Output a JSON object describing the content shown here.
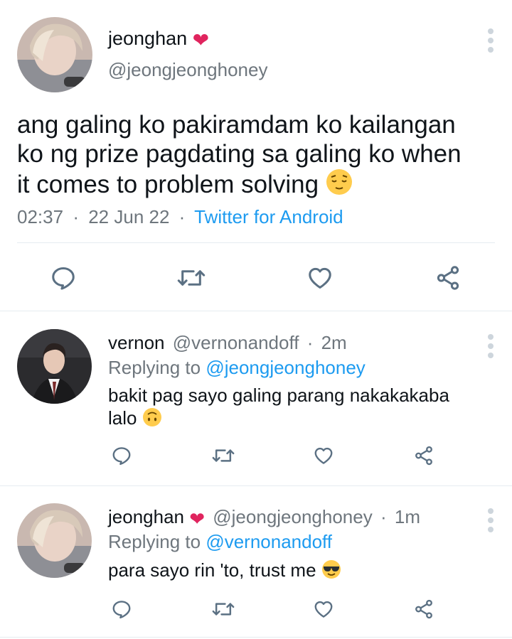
{
  "main_tweet": {
    "display_name": "jeonghan",
    "heart_emoji": "❤",
    "handle": "@jeongjeonghoney",
    "text_line1": "ang galing ko pakiramdam ko kailangan",
    "text_line2": "ko ng prize pagdating sa galing ko when",
    "text_line3": "it comes to problem solving",
    "time": "02:37",
    "date": "22 Jun 22",
    "sep": "·",
    "source": "Twitter for Android"
  },
  "reply1": {
    "display_name": "vernon",
    "handle": "@vernonandoff",
    "sep": "·",
    "age": "2m",
    "replying_prefix": "Replying to",
    "replying_to": "@jeongjeonghoney",
    "text_line1": "bakit pag sayo galing parang nakakakaba",
    "text_line2": "lalo"
  },
  "reply2": {
    "display_name": "jeonghan",
    "heart_emoji": "❤",
    "handle": "@jeongjeonghoney",
    "sep": "·",
    "age": "1m",
    "replying_prefix": "Replying to",
    "replying_to": "@vernonandoff",
    "text_line1": "para sayo rin 'to, trust me"
  },
  "colors": {
    "link": "#1d9bf0",
    "muted": "#6e767d",
    "heart": "#e0245e",
    "icon": "#5b7083",
    "divider": "#e6ecf0"
  },
  "icons": [
    "reply-icon",
    "retweet-icon",
    "like-icon",
    "share-icon",
    "more-options-icon"
  ]
}
